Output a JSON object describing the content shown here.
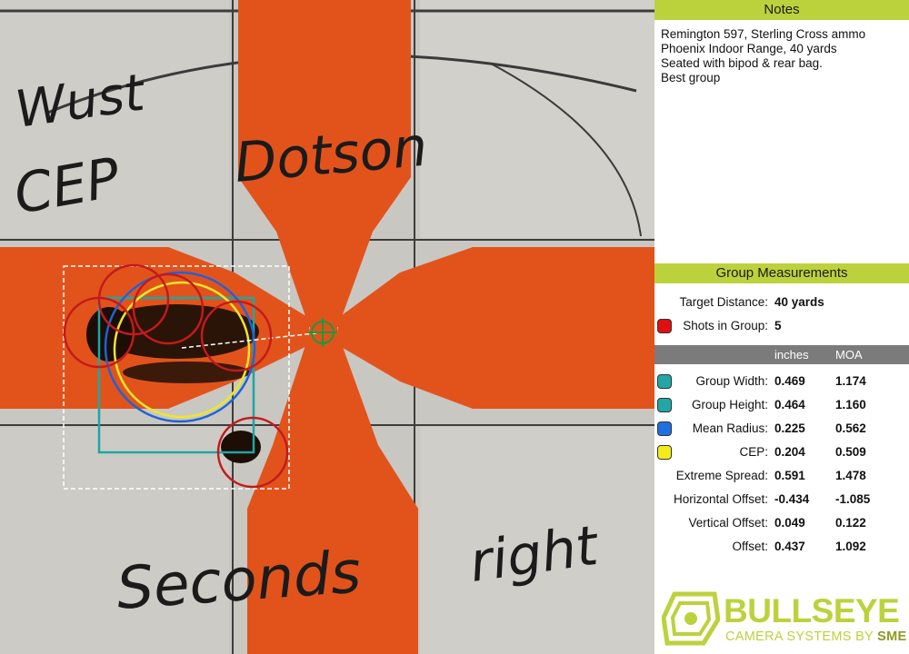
{
  "target_image": {
    "handwriting": [
      "Wust",
      "CEP",
      "Dotson",
      "Seconds",
      "right"
    ],
    "colors": {
      "orange": "#e2531c",
      "paper": "#c9c7c2",
      "shot_circle": "#c41a1a",
      "group_box": "#1fa5a5",
      "mean_radius": "#1e63d8",
      "cep": "#ede62a",
      "aim_point": "#1a9a3a"
    }
  },
  "notes": {
    "title": "Notes",
    "lines": [
      "Remington 597, Sterling Cross ammo",
      "Phoenix Indoor Range, 40 yards",
      "Seated with bipod & rear bag.",
      "Best group"
    ]
  },
  "measurements": {
    "title": "Group Measurements",
    "target_distance_label": "Target Distance:",
    "target_distance_value": "40 yards",
    "shots_label": "Shots in Group:",
    "shots_value": "5",
    "shots_color": "#e01010",
    "units": {
      "inches": "inches",
      "moa": "MOA"
    },
    "rows": [
      {
        "label": "Group Width:",
        "inches": "0.469",
        "moa": "1.174",
        "color": "#22a6a6"
      },
      {
        "label": "Group Height:",
        "inches": "0.464",
        "moa": "1.160",
        "color": "#22a6a6"
      },
      {
        "label": "Mean Radius:",
        "inches": "0.225",
        "moa": "0.562",
        "color": "#1e6fe0"
      },
      {
        "label": "CEP:",
        "inches": "0.204",
        "moa": "0.509",
        "color": "#f2ec1a"
      },
      {
        "label": "Extreme Spread:",
        "inches": "0.591",
        "moa": "1.478"
      },
      {
        "label": "Horizontal Offset:",
        "inches": "-0.434",
        "moa": "-1.085"
      },
      {
        "label": "Vertical Offset:",
        "inches": "0.049",
        "moa": "0.122"
      },
      {
        "label": "Offset:",
        "inches": "0.437",
        "moa": "1.092"
      }
    ]
  },
  "logo": {
    "word": "BULLSEYE",
    "sub_prefix": "CAMERA SYSTEMS BY ",
    "sub_brand": "SME",
    "color": "#bcd23c"
  }
}
